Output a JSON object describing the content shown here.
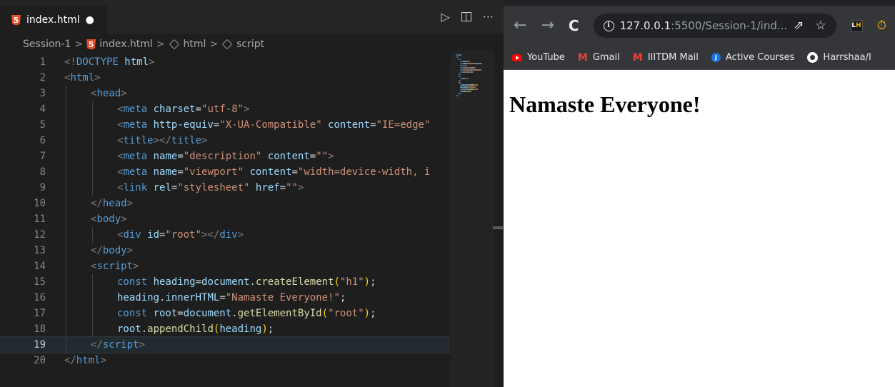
{
  "editor": {
    "tab": {
      "filename": "index.html",
      "dirty_marker": "●"
    },
    "actions": {
      "run_icon": "▷",
      "more_icon": "···"
    },
    "breadcrumb": [
      "Session-1",
      "index.html",
      "html",
      "script"
    ],
    "current_line": 19,
    "lines": [
      {
        "n": "1",
        "indent": 0,
        "tokens": [
          [
            "t",
            "<!"
          ],
          [
            "dt",
            "DOCTYPE "
          ],
          [
            "at",
            "html"
          ],
          [
            "t",
            ">"
          ]
        ]
      },
      {
        "n": "2",
        "indent": 0,
        "tokens": [
          [
            "t",
            "<"
          ],
          [
            "tn",
            "html"
          ],
          [
            "t",
            ">"
          ]
        ]
      },
      {
        "n": "3",
        "indent": 1,
        "tokens": [
          [
            "t",
            "<"
          ],
          [
            "tn",
            "head"
          ],
          [
            "t",
            ">"
          ]
        ]
      },
      {
        "n": "4",
        "indent": 2,
        "tokens": [
          [
            "t",
            "<"
          ],
          [
            "tn",
            "meta "
          ],
          [
            "at",
            "charset"
          ],
          [
            "",
            "="
          ],
          [
            "st",
            "\"utf-8\""
          ],
          [
            "t",
            ">"
          ]
        ]
      },
      {
        "n": "5",
        "indent": 2,
        "tokens": [
          [
            "t",
            "<"
          ],
          [
            "tn",
            "meta "
          ],
          [
            "at",
            "http-equiv"
          ],
          [
            "",
            "="
          ],
          [
            "st",
            "\"X-UA-Compatible\" "
          ],
          [
            "at",
            "content"
          ],
          [
            "",
            "="
          ],
          [
            "st",
            "\"IE=edge\""
          ]
        ]
      },
      {
        "n": "6",
        "indent": 2,
        "tokens": [
          [
            "t",
            "<"
          ],
          [
            "tn",
            "title"
          ],
          [
            "t",
            "></"
          ],
          [
            "tn",
            "title"
          ],
          [
            "t",
            ">"
          ]
        ]
      },
      {
        "n": "7",
        "indent": 2,
        "tokens": [
          [
            "t",
            "<"
          ],
          [
            "tn",
            "meta "
          ],
          [
            "at",
            "name"
          ],
          [
            "",
            "="
          ],
          [
            "st",
            "\"description\" "
          ],
          [
            "at",
            "content"
          ],
          [
            "",
            "="
          ],
          [
            "st",
            "\"\""
          ],
          [
            "t",
            ">"
          ]
        ]
      },
      {
        "n": "8",
        "indent": 2,
        "tokens": [
          [
            "t",
            "<"
          ],
          [
            "tn",
            "meta "
          ],
          [
            "at",
            "name"
          ],
          [
            "",
            "="
          ],
          [
            "st",
            "\"viewport\" "
          ],
          [
            "at",
            "content"
          ],
          [
            "",
            "="
          ],
          [
            "st",
            "\"width=device-width, i"
          ]
        ]
      },
      {
        "n": "9",
        "indent": 2,
        "tokens": [
          [
            "t",
            "<"
          ],
          [
            "tn",
            "link "
          ],
          [
            "at",
            "rel"
          ],
          [
            "",
            "="
          ],
          [
            "st",
            "\"stylesheet\" "
          ],
          [
            "at",
            "href"
          ],
          [
            "",
            "="
          ],
          [
            "st",
            "\"\""
          ],
          [
            "t",
            ">"
          ]
        ]
      },
      {
        "n": "10",
        "indent": 1,
        "tokens": [
          [
            "t",
            "</"
          ],
          [
            "tn",
            "head"
          ],
          [
            "t",
            ">"
          ]
        ]
      },
      {
        "n": "11",
        "indent": 1,
        "tokens": [
          [
            "t",
            "<"
          ],
          [
            "tn",
            "body"
          ],
          [
            "t",
            ">"
          ]
        ]
      },
      {
        "n": "12",
        "indent": 2,
        "tokens": [
          [
            "t",
            "<"
          ],
          [
            "tn",
            "div "
          ],
          [
            "at",
            "id"
          ],
          [
            "",
            "="
          ],
          [
            "st",
            "\"root\""
          ],
          [
            "t",
            "></"
          ],
          [
            "tn",
            "div"
          ],
          [
            "t",
            ">"
          ]
        ]
      },
      {
        "n": "13",
        "indent": 1,
        "tokens": [
          [
            "t",
            "</"
          ],
          [
            "tn",
            "body"
          ],
          [
            "t",
            ">"
          ]
        ]
      },
      {
        "n": "14",
        "indent": 1,
        "tokens": [
          [
            "t",
            "<"
          ],
          [
            "tn",
            "script"
          ],
          [
            "t",
            ">"
          ]
        ]
      },
      {
        "n": "15",
        "indent": 2,
        "tokens": [
          [
            "kw",
            "const "
          ],
          [
            "at",
            "heading"
          ],
          [
            "",
            "="
          ],
          [
            "at",
            "document"
          ],
          [
            "",
            "."
          ],
          [
            "fn",
            "createElement"
          ],
          [
            "pn",
            "("
          ],
          [
            "st",
            "\"h1\""
          ],
          [
            "pn",
            ")"
          ],
          [
            "",
            ";"
          ]
        ]
      },
      {
        "n": "16",
        "indent": 2,
        "tokens": [
          [
            "at",
            "heading"
          ],
          [
            "",
            "."
          ],
          [
            "at",
            "innerHTML"
          ],
          [
            "",
            "="
          ],
          [
            "st",
            "\"Namaste Everyone!\""
          ],
          [
            "",
            ";"
          ]
        ]
      },
      {
        "n": "17",
        "indent": 2,
        "tokens": [
          [
            "kw",
            "const "
          ],
          [
            "at",
            "root"
          ],
          [
            "",
            "="
          ],
          [
            "at",
            "document"
          ],
          [
            "",
            "."
          ],
          [
            "fn",
            "getElementById"
          ],
          [
            "pn",
            "("
          ],
          [
            "st",
            "\"root\""
          ],
          [
            "pn",
            ")"
          ],
          [
            "",
            ";"
          ]
        ]
      },
      {
        "n": "18",
        "indent": 2,
        "tokens": [
          [
            "at",
            "root"
          ],
          [
            "",
            "."
          ],
          [
            "fn",
            "appendChild"
          ],
          [
            "pn",
            "("
          ],
          [
            "at",
            "heading"
          ],
          [
            "pn",
            ")"
          ],
          [
            "",
            ";"
          ]
        ]
      },
      {
        "n": "19",
        "indent": 1,
        "tokens": [
          [
            "t",
            "</"
          ],
          [
            "tn",
            "script"
          ],
          [
            "t",
            ">"
          ]
        ]
      },
      {
        "n": "20",
        "indent": 0,
        "tokens": [
          [
            "t",
            "</"
          ],
          [
            "tn",
            "html"
          ],
          [
            "t",
            ">"
          ]
        ]
      }
    ]
  },
  "browser": {
    "url_host": "127.0.0.1",
    "url_rest": ":5500/Session-1/ind...",
    "extensions": {
      "lh_l": "L",
      "lh_h": "H",
      "timer_icon": "⏱"
    },
    "bookmarks": [
      "YouTube",
      "Gmail",
      "IIITDM Mail",
      "Active Courses",
      "Harrshaa/I"
    ],
    "page": {
      "heading": "Namaste Everyone!"
    }
  },
  "colors": {
    "editor_bg": "#1e1e1e",
    "tag": "#569cd6",
    "attribute": "#9cdcfe",
    "string": "#ce9178",
    "function": "#dcdcaa",
    "browser_chrome": "#35363a"
  }
}
